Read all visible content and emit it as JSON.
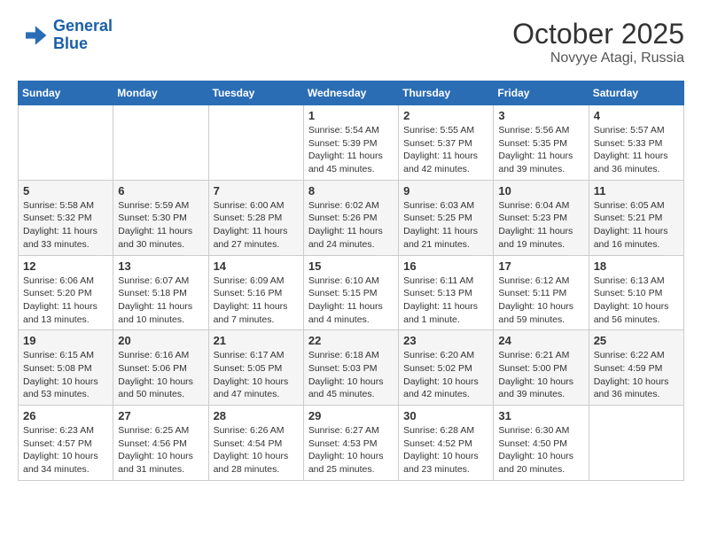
{
  "header": {
    "logo_line1": "General",
    "logo_line2": "Blue",
    "month": "October 2025",
    "location": "Novyye Atagi, Russia"
  },
  "weekdays": [
    "Sunday",
    "Monday",
    "Tuesday",
    "Wednesday",
    "Thursday",
    "Friday",
    "Saturday"
  ],
  "weeks": [
    [
      {
        "day": "",
        "info": ""
      },
      {
        "day": "",
        "info": ""
      },
      {
        "day": "",
        "info": ""
      },
      {
        "day": "1",
        "info": "Sunrise: 5:54 AM\nSunset: 5:39 PM\nDaylight: 11 hours\nand 45 minutes."
      },
      {
        "day": "2",
        "info": "Sunrise: 5:55 AM\nSunset: 5:37 PM\nDaylight: 11 hours\nand 42 minutes."
      },
      {
        "day": "3",
        "info": "Sunrise: 5:56 AM\nSunset: 5:35 PM\nDaylight: 11 hours\nand 39 minutes."
      },
      {
        "day": "4",
        "info": "Sunrise: 5:57 AM\nSunset: 5:33 PM\nDaylight: 11 hours\nand 36 minutes."
      }
    ],
    [
      {
        "day": "5",
        "info": "Sunrise: 5:58 AM\nSunset: 5:32 PM\nDaylight: 11 hours\nand 33 minutes."
      },
      {
        "day": "6",
        "info": "Sunrise: 5:59 AM\nSunset: 5:30 PM\nDaylight: 11 hours\nand 30 minutes."
      },
      {
        "day": "7",
        "info": "Sunrise: 6:00 AM\nSunset: 5:28 PM\nDaylight: 11 hours\nand 27 minutes."
      },
      {
        "day": "8",
        "info": "Sunrise: 6:02 AM\nSunset: 5:26 PM\nDaylight: 11 hours\nand 24 minutes."
      },
      {
        "day": "9",
        "info": "Sunrise: 6:03 AM\nSunset: 5:25 PM\nDaylight: 11 hours\nand 21 minutes."
      },
      {
        "day": "10",
        "info": "Sunrise: 6:04 AM\nSunset: 5:23 PM\nDaylight: 11 hours\nand 19 minutes."
      },
      {
        "day": "11",
        "info": "Sunrise: 6:05 AM\nSunset: 5:21 PM\nDaylight: 11 hours\nand 16 minutes."
      }
    ],
    [
      {
        "day": "12",
        "info": "Sunrise: 6:06 AM\nSunset: 5:20 PM\nDaylight: 11 hours\nand 13 minutes."
      },
      {
        "day": "13",
        "info": "Sunrise: 6:07 AM\nSunset: 5:18 PM\nDaylight: 11 hours\nand 10 minutes."
      },
      {
        "day": "14",
        "info": "Sunrise: 6:09 AM\nSunset: 5:16 PM\nDaylight: 11 hours\nand 7 minutes."
      },
      {
        "day": "15",
        "info": "Sunrise: 6:10 AM\nSunset: 5:15 PM\nDaylight: 11 hours\nand 4 minutes."
      },
      {
        "day": "16",
        "info": "Sunrise: 6:11 AM\nSunset: 5:13 PM\nDaylight: 11 hours\nand 1 minute."
      },
      {
        "day": "17",
        "info": "Sunrise: 6:12 AM\nSunset: 5:11 PM\nDaylight: 10 hours\nand 59 minutes."
      },
      {
        "day": "18",
        "info": "Sunrise: 6:13 AM\nSunset: 5:10 PM\nDaylight: 10 hours\nand 56 minutes."
      }
    ],
    [
      {
        "day": "19",
        "info": "Sunrise: 6:15 AM\nSunset: 5:08 PM\nDaylight: 10 hours\nand 53 minutes."
      },
      {
        "day": "20",
        "info": "Sunrise: 6:16 AM\nSunset: 5:06 PM\nDaylight: 10 hours\nand 50 minutes."
      },
      {
        "day": "21",
        "info": "Sunrise: 6:17 AM\nSunset: 5:05 PM\nDaylight: 10 hours\nand 47 minutes."
      },
      {
        "day": "22",
        "info": "Sunrise: 6:18 AM\nSunset: 5:03 PM\nDaylight: 10 hours\nand 45 minutes."
      },
      {
        "day": "23",
        "info": "Sunrise: 6:20 AM\nSunset: 5:02 PM\nDaylight: 10 hours\nand 42 minutes."
      },
      {
        "day": "24",
        "info": "Sunrise: 6:21 AM\nSunset: 5:00 PM\nDaylight: 10 hours\nand 39 minutes."
      },
      {
        "day": "25",
        "info": "Sunrise: 6:22 AM\nSunset: 4:59 PM\nDaylight: 10 hours\nand 36 minutes."
      }
    ],
    [
      {
        "day": "26",
        "info": "Sunrise: 6:23 AM\nSunset: 4:57 PM\nDaylight: 10 hours\nand 34 minutes."
      },
      {
        "day": "27",
        "info": "Sunrise: 6:25 AM\nSunset: 4:56 PM\nDaylight: 10 hours\nand 31 minutes."
      },
      {
        "day": "28",
        "info": "Sunrise: 6:26 AM\nSunset: 4:54 PM\nDaylight: 10 hours\nand 28 minutes."
      },
      {
        "day": "29",
        "info": "Sunrise: 6:27 AM\nSunset: 4:53 PM\nDaylight: 10 hours\nand 25 minutes."
      },
      {
        "day": "30",
        "info": "Sunrise: 6:28 AM\nSunset: 4:52 PM\nDaylight: 10 hours\nand 23 minutes."
      },
      {
        "day": "31",
        "info": "Sunrise: 6:30 AM\nSunset: 4:50 PM\nDaylight: 10 hours\nand 20 minutes."
      },
      {
        "day": "",
        "info": ""
      }
    ]
  ]
}
